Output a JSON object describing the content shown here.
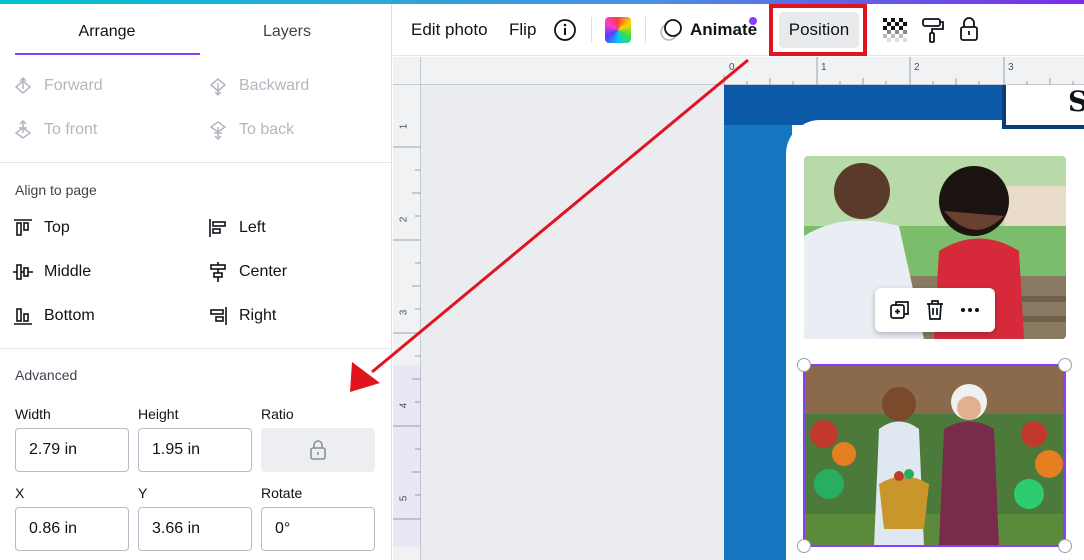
{
  "panel": {
    "tabs": [
      {
        "label": "Arrange",
        "active": true
      },
      {
        "label": "Layers",
        "active": false
      }
    ],
    "arrange": {
      "forward": "Forward",
      "backward": "Backward",
      "to_front": "To front",
      "to_back": "To back"
    },
    "align_title": "Align to page",
    "align": {
      "top": "Top",
      "left": "Left",
      "middle": "Middle",
      "center": "Center",
      "bottom": "Bottom",
      "right": "Right"
    },
    "advanced_title": "Advanced",
    "fields": {
      "width_label": "Width",
      "width_value": "2.79 in",
      "height_label": "Height",
      "height_value": "1.95 in",
      "ratio_label": "Ratio",
      "x_label": "X",
      "x_value": "0.86 in",
      "y_label": "Y",
      "y_value": "3.66 in",
      "rotate_label": "Rotate",
      "rotate_value": "0°"
    }
  },
  "toolbar": {
    "edit_photo": "Edit photo",
    "flip": "Flip",
    "animate": "Animate",
    "position": "Position",
    "icons": [
      "info-icon",
      "color-swatch-icon",
      "animate-icon",
      "transparency-icon",
      "paint-roller-icon",
      "lock-icon"
    ]
  },
  "rulers": {
    "top": [
      "0",
      "1",
      "2",
      "3"
    ],
    "left": [
      "1",
      "2",
      "3",
      "4",
      "5"
    ]
  },
  "canvas": {
    "title_letter": "S",
    "context_menu": [
      "duplicate-icon",
      "trash-icon",
      "more-icon"
    ]
  },
  "colors": {
    "accent": "#8b3dff",
    "annotation": "#e0141f",
    "brand_blue": "#1577c0"
  }
}
